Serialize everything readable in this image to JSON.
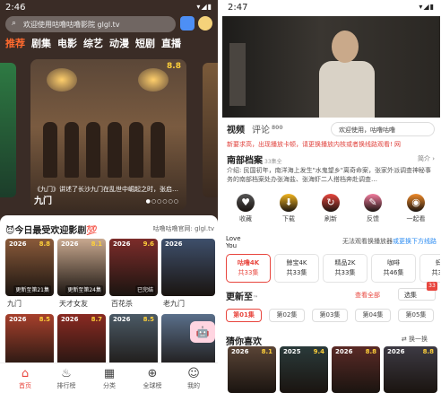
{
  "left": {
    "time": "2:46",
    "search_placeholder": "欢迎使用咕噜咕噜影院 glgl.tv",
    "categories": [
      "推荐",
      "剧集",
      "电影",
      "综艺",
      "动漫",
      "短剧",
      "直播"
    ],
    "banner": {
      "score": "8.8",
      "caption": "《九门》讲述了长沙九门在乱世中崛起之时，张启…",
      "title": "九门"
    },
    "section": {
      "title": "😈今日最受欢迎影剧💯",
      "site": "咕噜咕噜官网: glgl.tv"
    },
    "cards": [
      {
        "year": "2026",
        "score": "8.8",
        "ep": "更新至第21集",
        "name": "九门",
        "color": "#8a5a3a"
      },
      {
        "year": "2026",
        "score": "8.1",
        "ep": "更新至第24集",
        "name": "天才女友",
        "color": "#c8a88f"
      },
      {
        "year": "2026",
        "score": "9.6",
        "ep": "已完结",
        "name": "百花杀",
        "color": "#7c2c2a"
      },
      {
        "year": "2026",
        "score": "",
        "ep": "",
        "name": "老九门",
        "color": "#3e4f6b"
      },
      {
        "year": "2026",
        "score": "8.5",
        "ep": "",
        "name": "",
        "color": "#a7402c"
      },
      {
        "year": "2026",
        "score": "8.7",
        "ep": "",
        "name": "",
        "color": "#8a2a22"
      },
      {
        "year": "2026",
        "score": "8.5",
        "ep": "",
        "name": "",
        "color": "#4b5a66"
      },
      {
        "year": "",
        "score": "",
        "ep": "",
        "name": "",
        "color": "#5a6f8a"
      }
    ],
    "nav": [
      {
        "icon": "home-icon",
        "glyph": "⌂",
        "label": "首页",
        "active": true
      },
      {
        "icon": "fire-icon",
        "glyph": "♨",
        "label": "排行榜",
        "active": false
      },
      {
        "icon": "category-icon",
        "glyph": "▦",
        "label": "分类",
        "active": false
      },
      {
        "icon": "globe-icon",
        "glyph": "⊕",
        "label": "全球榜",
        "active": false
      },
      {
        "icon": "profile-icon",
        "glyph": "☺",
        "label": "我的",
        "active": false
      }
    ]
  },
  "right": {
    "time": "2:47",
    "tabs": {
      "video": "视频",
      "comment": "评论",
      "comment_count": "800"
    },
    "welcome": "欢迎使用，咕噜咕噜",
    "notice": "新要求高，出现播放卡顿，请更换播放内核或者换线路观看! 网",
    "title": "南部档案",
    "title_suffix": "33集全",
    "intro": "简介 ›",
    "desc": "介绍: 民国初年，南洋海上发生\"水鬼望乡\"离奇命案，张家外派调查神秘事务的南部档案处办张海盐、张海虾二人搭档奔赴调查…",
    "actions": [
      {
        "label": "收藏",
        "glyph": "♥",
        "color": "#555"
      },
      {
        "label": "下载",
        "glyph": "⬇",
        "color": "#f2b51f"
      },
      {
        "label": "刷新",
        "glyph": "↻",
        "color": "#e8463e"
      },
      {
        "label": "反馈",
        "glyph": "✎",
        "color": "#f27c9e"
      },
      {
        "label": "一起看",
        "glyph": "◉",
        "color": "#ef8a2a"
      }
    ],
    "love": "Love You",
    "love_text": "无法观看换播放器",
    "love_link": "或更换下方线路",
    "sources": [
      {
        "name": "咕噜4K",
        "count": "共33集",
        "active": true
      },
      {
        "name": "鲸宝4K",
        "count": "共33集",
        "active": false
      },
      {
        "name": "精品2K",
        "count": "共33集",
        "active": false
      },
      {
        "name": "咖啡",
        "count": "共46集",
        "active": false
      },
      {
        "name": "蚂蚁",
        "count": "共33集",
        "active": false
      }
    ],
    "update": "更新至",
    "update_suffix": "™",
    "view_all": "查看全部",
    "select_ep": "选集",
    "badge": "33",
    "episodes": [
      "第01集",
      "第02集",
      "第03集",
      "第04集",
      "第05集"
    ],
    "guess": "猜你喜欢",
    "swap": "换一换",
    "rec": [
      {
        "year": "2026",
        "score": "8.1",
        "color": "#5a4436"
      },
      {
        "year": "2025",
        "score": "9.4",
        "color": "#2a3a3a"
      },
      {
        "year": "2026",
        "score": "8.8",
        "color": "#5a2a26"
      },
      {
        "year": "2026",
        "score": "8.8",
        "color": "#3d3a44"
      }
    ]
  }
}
